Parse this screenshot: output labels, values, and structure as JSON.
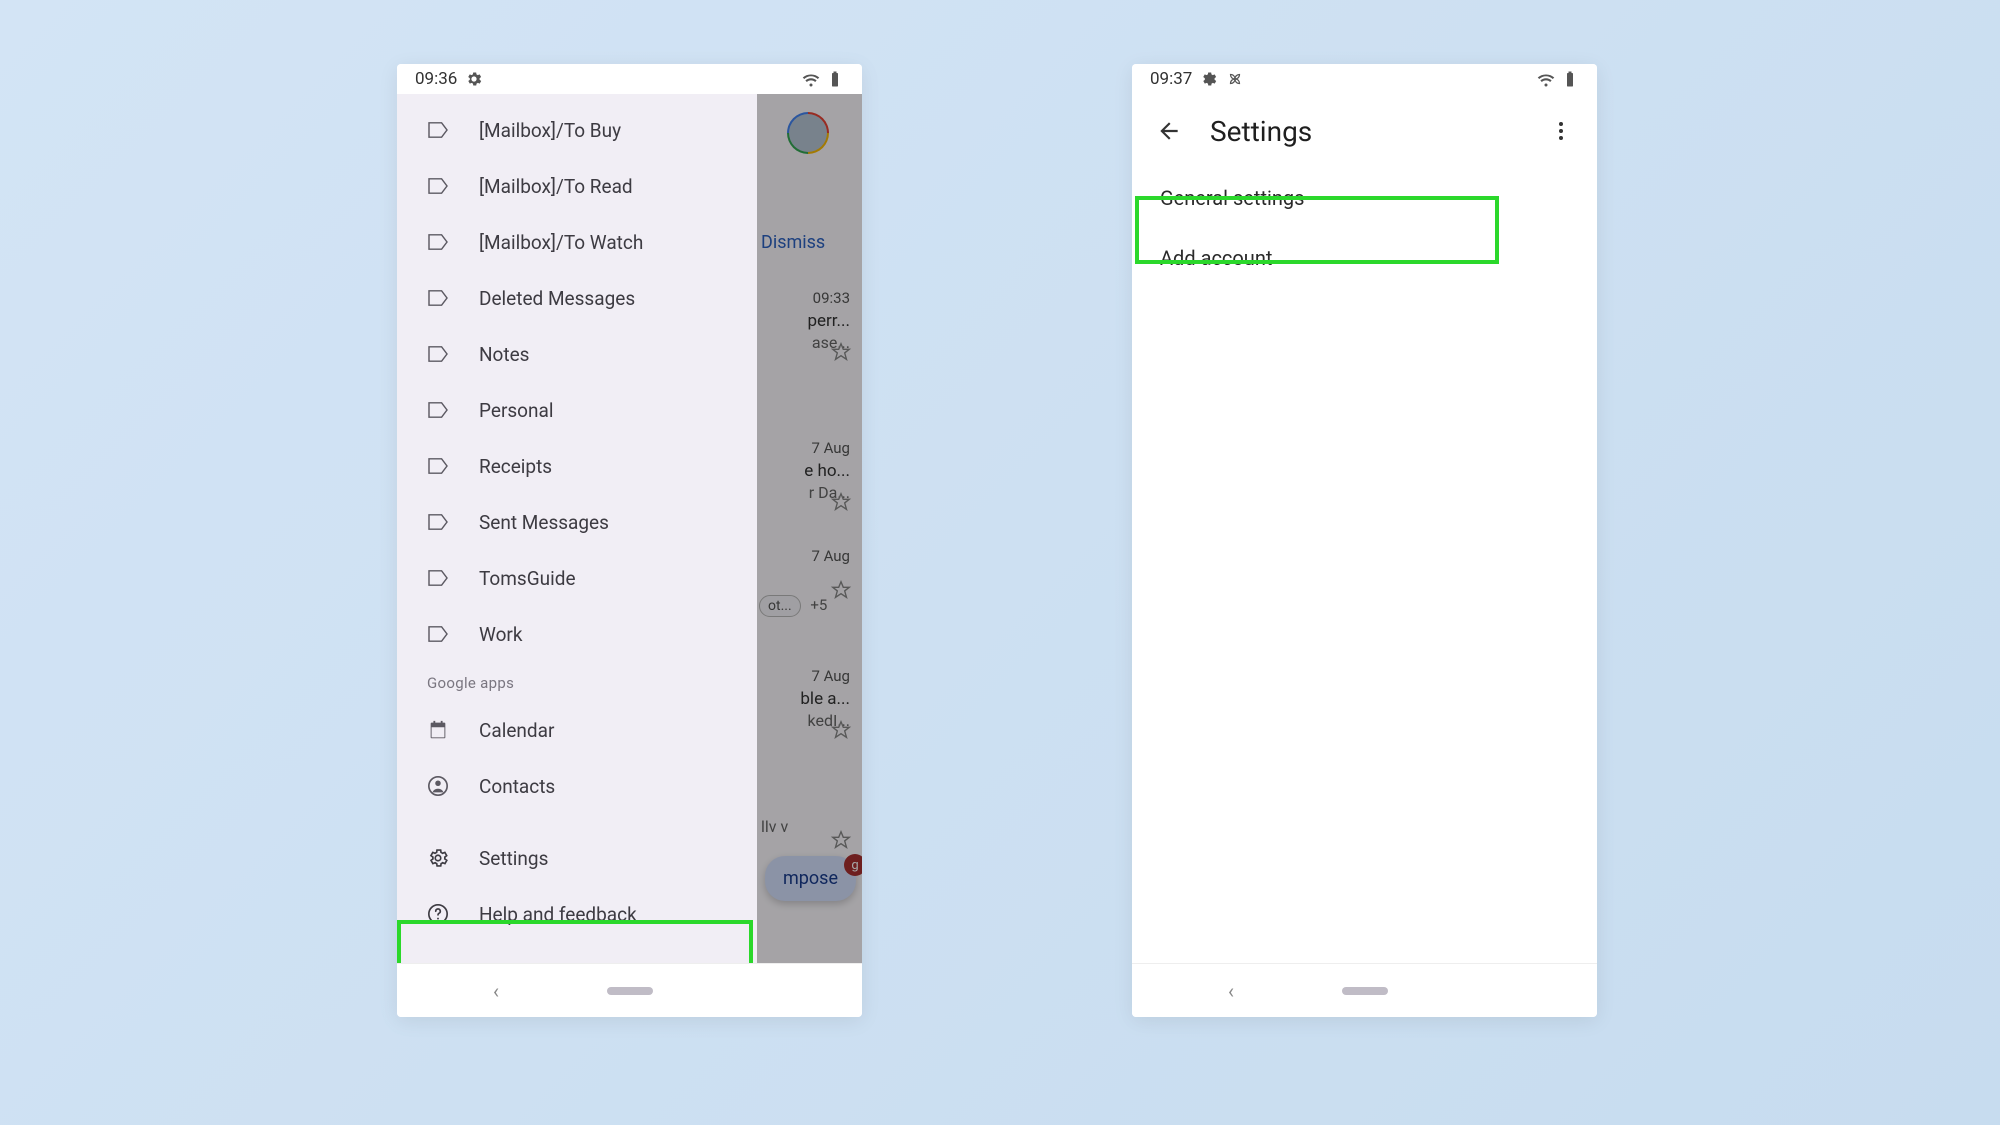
{
  "phone1": {
    "status": {
      "time": "09:36"
    },
    "labels": [
      "[Mailbox]/To Buy",
      "[Mailbox]/To Read",
      "[Mailbox]/To Watch",
      "Deleted Messages",
      "Notes",
      "Personal",
      "Receipts",
      "Sent Messages",
      "TomsGuide",
      "Work"
    ],
    "section_google_apps": "Google apps",
    "apps": {
      "calendar": "Calendar",
      "contacts": "Contacts"
    },
    "settings": "Settings",
    "help": "Help and feedback",
    "inbox": {
      "dismiss": "Dismiss",
      "row1_time": "09:33",
      "row1_snip": "perr...",
      "row1_snip2": "ase...",
      "row2_time": "7 Aug",
      "row2_snip": "e ho...",
      "row2_snip2": "r Da...",
      "row3_time": "7 Aug",
      "row3_chip": "ot...",
      "row3_plus": "+5",
      "row4_time": "7 Aug",
      "row4_snip": "ble a...",
      "row4_snip2": "kedI...",
      "compose": "mpose",
      "compose_badge": "g",
      "row5_snip": "llv v"
    }
  },
  "phone2": {
    "status": {
      "time": "09:37"
    },
    "title": "Settings",
    "items": {
      "general": "General settings",
      "add_account": "Add account"
    }
  }
}
